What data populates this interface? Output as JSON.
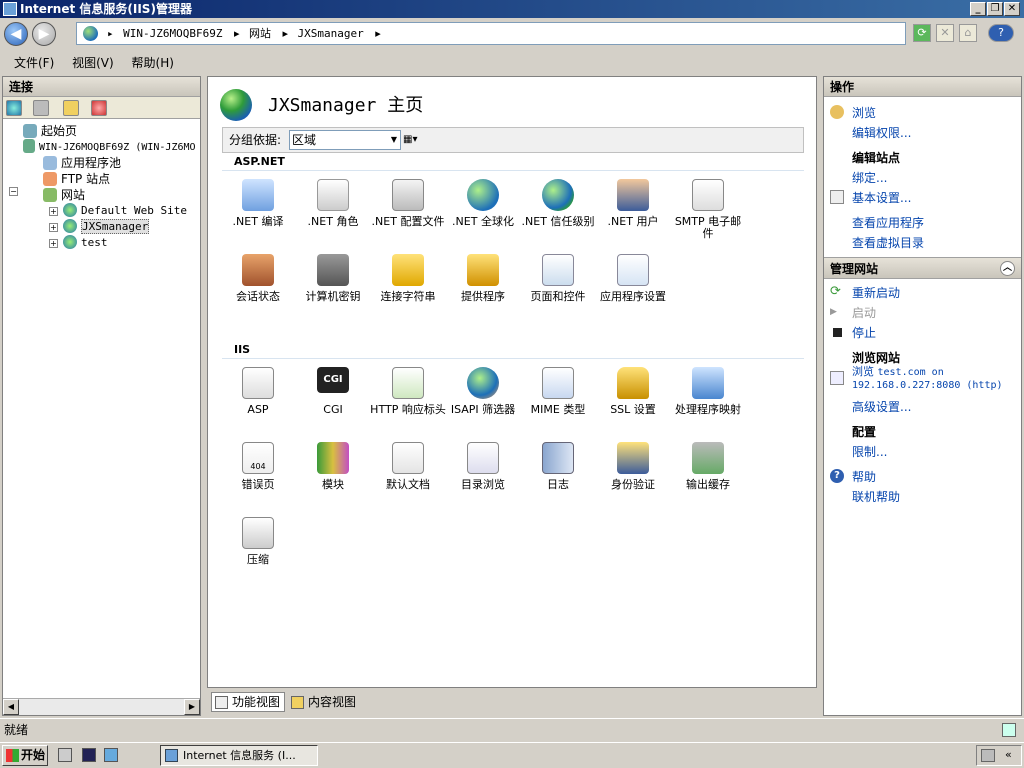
{
  "window": {
    "title": "Internet 信息服务(IIS)管理器",
    "minimize": "_",
    "restore": "❐",
    "close": "✕"
  },
  "nav": {
    "breadcrumb": [
      "WIN-JZ6MOQBF69Z",
      "网站",
      "JXSmanager"
    ],
    "separator": "▸",
    "help_label": "?"
  },
  "menu": [
    "文件(F)",
    "视图(V)",
    "帮助(H)"
  ],
  "connections": {
    "title": "连接",
    "tree": [
      {
        "label": "起始页",
        "level": 1
      },
      {
        "label": "WIN-JZ6MOQBF69Z (WIN-JZ6MO",
        "level": 0
      },
      {
        "label": "应用程序池",
        "level": 2
      },
      {
        "label": "FTP 站点",
        "level": 2
      },
      {
        "label": "网站",
        "level": 1
      },
      {
        "label": "Default Web Site",
        "level": 2
      },
      {
        "label": "JXSmanager",
        "level": 2,
        "selected": true
      },
      {
        "label": "test",
        "level": 2
      }
    ]
  },
  "center": {
    "title": "JXSmanager 主页",
    "group_label": "分组依据:",
    "group_value": "区域",
    "sections": [
      {
        "name": "ASP.NET",
        "items": [
          ".NET 编译",
          ".NET 角色",
          ".NET 配置文件",
          ".NET 全球化",
          ".NET 信任级别",
          ".NET 用户",
          "SMTP 电子邮件",
          "会话状态",
          "计算机密钥",
          "连接字符串",
          "提供程序",
          "页面和控件",
          "应用程序设置"
        ]
      },
      {
        "name": "IIS",
        "items": [
          "ASP",
          "CGI",
          "HTTP 响应标头",
          "ISAPI 筛选器",
          "MIME 类型",
          "SSL 设置",
          "处理程序映射",
          "错误页",
          "模块",
          "默认文档",
          "目录浏览",
          "日志",
          "身份验证",
          "输出缓存",
          "压缩"
        ]
      }
    ],
    "tabs": [
      "功能视图",
      "内容视图"
    ]
  },
  "actions": {
    "title": "操作",
    "browse": "浏览",
    "edit_permissions": "编辑权限...",
    "edit_site": "编辑站点",
    "bindings": "绑定...",
    "basic_settings": "基本设置...",
    "view_apps": "查看应用程序",
    "view_vdirs": "查看虚拟目录",
    "manage_site": "管理网站",
    "restart": "重新启动",
    "start": "启动",
    "stop": "停止",
    "browse_site": "浏览网站",
    "browse_prefix": "浏览",
    "browse_target_1": "test.com on",
    "browse_target_2": "192.168.0.227:8080 (http)",
    "advanced_settings": "高级设置...",
    "config": "配置",
    "limits": "限制...",
    "help": "帮助",
    "online_help": "联机帮助"
  },
  "status": {
    "text": "就绪"
  },
  "taskbar": {
    "start": "开始",
    "item": "Internet 信息服务 (I..."
  }
}
